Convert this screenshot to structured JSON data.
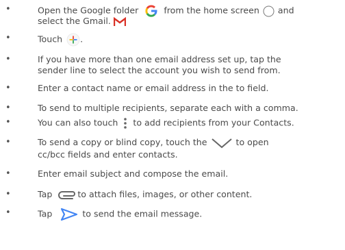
{
  "bullet_char": "•",
  "step1": {
    "line1_a": "Open the Google folder",
    "line1_b": "from the home screen",
    "line1_c": "and",
    "line2_a": "select the Gmail."
  },
  "step2": {
    "a": "Touch",
    "b": "."
  },
  "step3": {
    "line1": "If you have more than one email address set up, tap the",
    "line2": "sender line to select the account you wish to send from."
  },
  "step4": "Enter a contact name or email address in the to field.",
  "step5": "To send to multiple recipients, separate each with a comma.",
  "step6": {
    "a": "You can also touch",
    "b": "to add recipients from your Contacts."
  },
  "step7": {
    "line1_a": "To send a copy or blind copy, touch the",
    "line1_b": "to open",
    "line2": "cc/bcc fields and enter contacts."
  },
  "step8": "Enter email subject and compose the email.",
  "step9": {
    "a": "Tap",
    "b": "to attach files, images, or other content."
  },
  "step10": {
    "a": "Tap",
    "b": "to send the email message."
  },
  "icons": {
    "google": "google-g-icon",
    "home": "home-circle-icon",
    "gmail": "gmail-m-icon",
    "compose": "compose-plus-icon",
    "more": "more-vertical-dots-icon",
    "chevron": "chevron-down-icon",
    "attach": "paperclip-icon",
    "send": "send-icon"
  },
  "colors": {
    "text": "#4a4a4a",
    "google_blue": "#4285F4",
    "google_red": "#EA4335",
    "google_yellow": "#FBBC05",
    "google_green": "#34A853",
    "gmail_red": "#D93025",
    "send_blue": "#4285F4"
  }
}
